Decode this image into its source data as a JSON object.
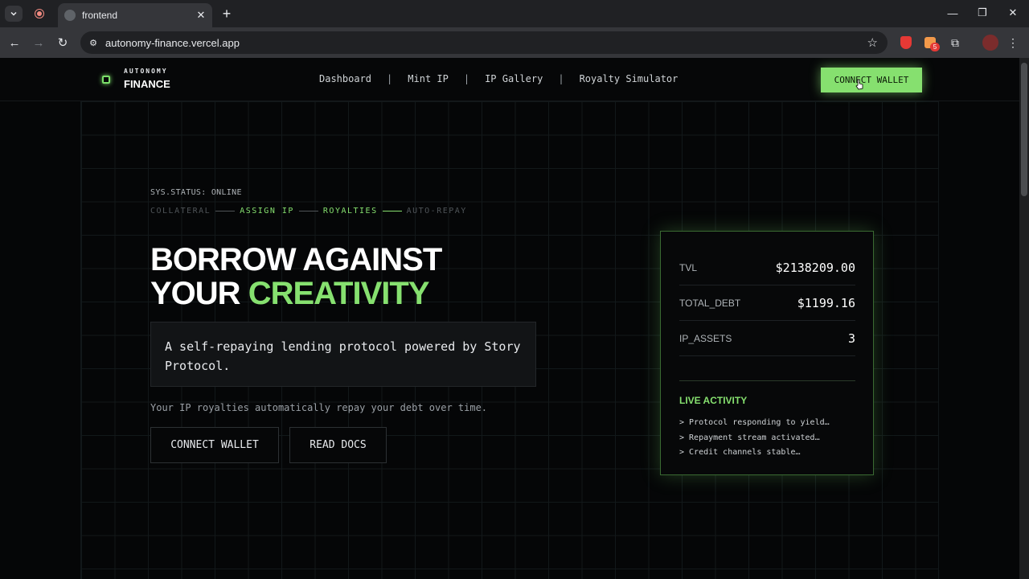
{
  "browser": {
    "tab_title": "frontend",
    "url": "autonomy-finance.vercel.app",
    "extension_badge": "5"
  },
  "site": {
    "logo_top": "AUTONOMY",
    "logo_bottom": "FINANCE",
    "nav": [
      "Dashboard",
      "Mint IP",
      "IP Gallery",
      "Royalty Simulator"
    ],
    "nav_separator": "|",
    "connect_wallet_top": "CONNECT WALLET"
  },
  "hero": {
    "status": "SYS.STATUS: ONLINE",
    "steps": [
      {
        "label": "COLLATERAL",
        "color": "#4f5458"
      },
      {
        "label": "ASSIGN IP",
        "color": "#86e06f"
      },
      {
        "label": "ROYALTIES",
        "color": "#86e06f"
      },
      {
        "label": "AUTO-REPAY",
        "color": "#4f5458"
      }
    ],
    "headline_line1": "BORROW AGAINST",
    "headline_line2_plain": "YOUR ",
    "headline_line2_accent": "CREATIVITY",
    "description": "A self-repaying lending protocol powered by Story Protocol.",
    "subtext": "Your IP royalties automatically repay your debt over time.",
    "btn_connect": "CONNECT WALLET",
    "btn_docs": "READ DOCS"
  },
  "stats": {
    "tvl_label": "TVL",
    "tvl_value": "$2138209.00",
    "debt_label": "TOTAL_DEBT",
    "debt_value": "$1199.16",
    "assets_label": "IP_ASSETS",
    "assets_value": "3",
    "live_title": "LIVE ACTIVITY",
    "live_items": [
      "> Protocol responding to yield…",
      "> Repayment stream activated…",
      "> Credit channels stable…"
    ]
  },
  "colors": {
    "accent": "#86e06f",
    "background": "#050607"
  }
}
